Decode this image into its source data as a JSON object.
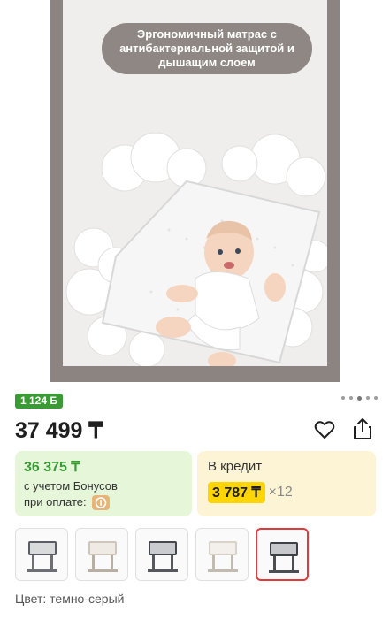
{
  "hero": {
    "caption_lines": [
      "Эргономичный матрас с",
      "антибактериальной защитой и",
      "дышащим слоем"
    ]
  },
  "product": {
    "bonus_badge": "1 124 Б",
    "price": "37 499 ₸"
  },
  "bonus_card": {
    "price": "36 375 ₸",
    "line1": "с учетом Бонусов",
    "line2": "при оплате:"
  },
  "credit_card": {
    "title": "В кредит",
    "amount": "3 787 ₸",
    "multiplier": "×12"
  },
  "thumbnails": [
    {
      "alt": "crib-dark-1"
    },
    {
      "alt": "crib-light-1"
    },
    {
      "alt": "crib-dark-2"
    },
    {
      "alt": "crib-light-2"
    },
    {
      "alt": "crib-dark-3"
    }
  ],
  "color": {
    "label": "Цвет: темно-серый"
  },
  "colors": {
    "accent_green": "#3a9b35",
    "credit_yellow": "#ffd500",
    "selected_border": "#e03a3a"
  }
}
